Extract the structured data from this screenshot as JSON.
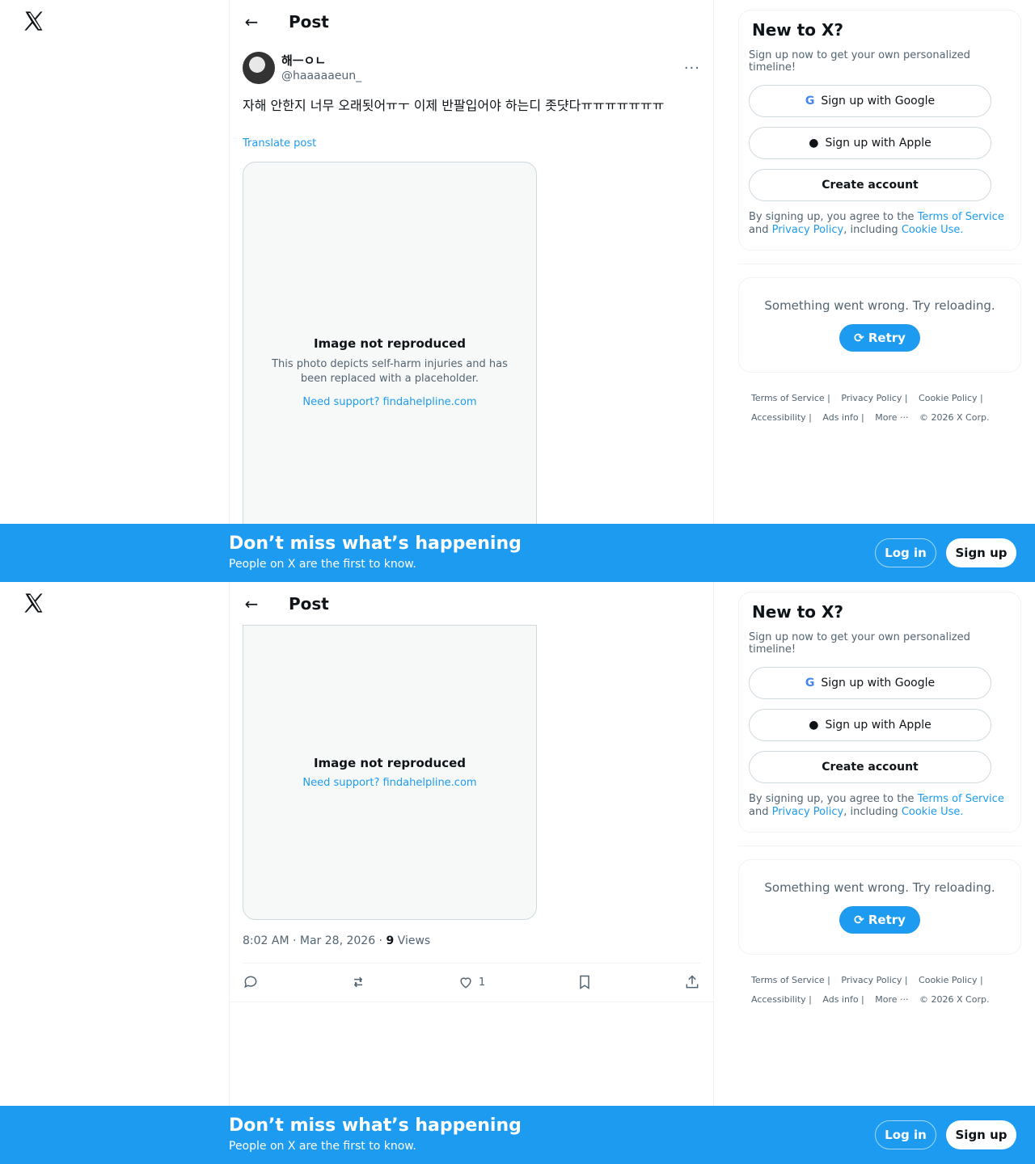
{
  "header": {
    "title": "Post"
  },
  "post": {
    "author_name": "해ㅡㅇㄴ",
    "author_handle": "@haaaaaeun_",
    "text": "자해 안한지 너무 오래됫어ㅠㅜ 이제 반팔입어야 하는디 좃댯다ㅠㅠㅠㅠㅠㅠㅠ",
    "translate_label": "Translate post",
    "time": "8:02 AM · Mar 28, 2026 · ",
    "views_count": "9",
    "views_label": " Views",
    "likes": "1"
  },
  "media_notice": {
    "title": "Image not reproduced",
    "text": "This photo depicts self-harm injuries and has been replaced with a placeholder.",
    "link": "Need support? findahelpline.com"
  },
  "signup_card": {
    "title": "New to X?",
    "subtitle": "Sign up now to get your own personalized timeline!",
    "google": "Sign up with Google",
    "apple": "Sign up with Apple",
    "create": "Create account",
    "legal_1": "By signing up, you agree to the ",
    "terms": "Terms of Service",
    "legal_2": " and ",
    "privacy": "Privacy Policy",
    "legal_3": ", including ",
    "cookie": "Cookie Use."
  },
  "error_card": {
    "text": "Something went wrong. Try reloading.",
    "retry": "Retry"
  },
  "footer": {
    "terms": "Terms of Service  |",
    "privacy": "Privacy Policy  |",
    "cookie": "Cookie Policy  |",
    "accessibility": "Accessibility  |",
    "ads": "Ads info  |",
    "more": "More ···",
    "copyright": "© 2026 X Corp."
  },
  "banner": {
    "title": "Don’t miss what’s happening",
    "subtitle": "People on X are the first to know.",
    "login": "Log in",
    "signup": "Sign up"
  }
}
